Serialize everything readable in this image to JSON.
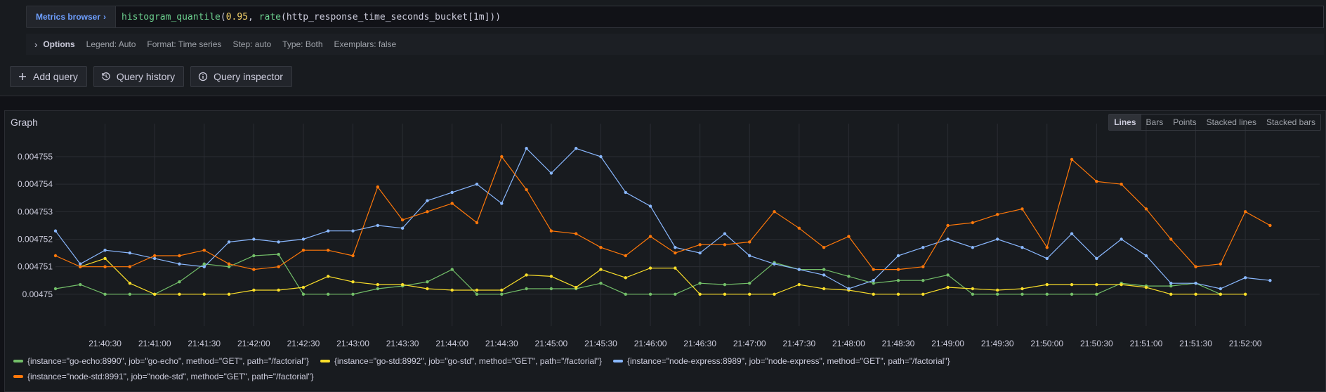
{
  "query": {
    "metrics_browser_label": "Metrics browser",
    "expr_fn1": "histogram_quantile",
    "expr_open1": "(",
    "expr_num1": "0.95",
    "expr_sep1": ", ",
    "expr_fn2": "rate",
    "expr_rest": "(http_response_time_seconds_bucket[1m]))"
  },
  "options": {
    "title": "Options",
    "legend": "Legend: Auto",
    "format": "Format: Time series",
    "step": "Step: auto",
    "type": "Type: Both",
    "exemplars": "Exemplars: false"
  },
  "buttons": {
    "add_query": "Add query",
    "query_history": "Query history",
    "query_inspector": "Query inspector"
  },
  "graph": {
    "title": "Graph",
    "vis_options": [
      "Lines",
      "Bars",
      "Points",
      "Stacked lines",
      "Stacked bars"
    ],
    "active_vis": "Lines"
  },
  "chart_data": {
    "type": "line",
    "ylim": [
      0.004749,
      0.0047562
    ],
    "x_ticks": [
      "21:40:30",
      "21:41:00",
      "21:41:30",
      "21:42:00",
      "21:42:30",
      "21:43:00",
      "21:43:30",
      "21:44:00",
      "21:44:30",
      "21:45:00",
      "21:45:30",
      "21:46:00",
      "21:46:30",
      "21:47:00",
      "21:47:30",
      "21:48:00",
      "21:48:30",
      "21:49:00",
      "21:49:30",
      "21:50:00",
      "21:50:30",
      "21:51:00",
      "21:51:30",
      "21:52:00"
    ],
    "y_ticks": [
      "0.004755",
      "0.004754",
      "0.004753",
      "0.004752",
      "0.004751",
      "0.00475"
    ],
    "y_tick_values": [
      0.004755,
      0.004754,
      0.004753,
      0.004752,
      0.004751,
      0.00475
    ],
    "x_start": "21:40:00",
    "x_step_seconds": 15,
    "grid": true,
    "legend_position": "bottom",
    "series": [
      {
        "name": "{instance=\"go-echo:8990\", job=\"go-echo\", method=\"GET\", path=\"/factorial\"}",
        "color": "#73bf69",
        "values": [
          0.0047502,
          0.00475035,
          0.00475,
          0.00475,
          0.00475,
          0.00475045,
          0.0047511,
          0.004751,
          0.0047514,
          0.00475145,
          0.00475,
          0.00475,
          0.00475,
          0.0047502,
          0.0047503,
          0.00475045,
          0.0047509,
          0.00475,
          0.00475,
          0.0047502,
          0.0047502,
          0.0047502,
          0.0047504,
          0.00475,
          0.00475,
          0.00475,
          0.0047504,
          0.00475035,
          0.0047504,
          0.00475115,
          0.0047509,
          0.0047509,
          0.00475065,
          0.0047504,
          0.0047505,
          0.0047505,
          0.0047507,
          0.00475,
          0.00475,
          0.00475,
          0.00475,
          0.00475,
          0.00475,
          0.0047504,
          0.0047503,
          0.0047503,
          0.0047504,
          0.00475
        ]
      },
      {
        "name": "{instance=\"go-std:8992\", job=\"go-std\", method=\"GET\", path=\"/factorial\"}",
        "color": "#fade2a",
        "values": [
          null,
          0.004751,
          0.0047513,
          0.0047504,
          0.00475,
          0.00475,
          0.00475,
          0.00475,
          0.00475015,
          0.00475015,
          0.00475025,
          0.00475065,
          0.00475045,
          0.00475035,
          0.00475035,
          0.0047502,
          0.00475015,
          0.00475015,
          0.00475015,
          0.0047507,
          0.00475065,
          0.00475025,
          0.0047509,
          0.0047506,
          0.00475095,
          0.00475095,
          0.00475,
          0.00475,
          0.00475,
          0.00475,
          0.00475035,
          0.0047502,
          0.00475015,
          0.00475,
          0.00475,
          0.00475,
          0.00475025,
          0.0047502,
          0.00475015,
          0.0047502,
          0.00475035,
          0.00475035,
          0.00475035,
          0.00475035,
          0.00475025,
          0.00475,
          0.00475,
          0.00475,
          0.00475
        ]
      },
      {
        "name": "{instance=\"node-express:8989\", job=\"node-express\", method=\"GET\", path=\"/factorial\"}",
        "color": "#8ab8ff",
        "values": [
          0.0047523,
          0.0047511,
          0.0047516,
          0.0047515,
          0.0047513,
          0.0047511,
          0.004751,
          0.0047519,
          0.004752,
          0.0047519,
          0.004752,
          0.0047523,
          0.0047523,
          0.0047525,
          0.0047524,
          0.0047534,
          0.0047537,
          0.004754,
          0.0047533,
          0.0047553,
          0.0047544,
          0.0047553,
          0.004755,
          0.0047537,
          0.0047532,
          0.0047517,
          0.0047515,
          0.0047522,
          0.0047514,
          0.0047511,
          0.0047509,
          0.0047507,
          0.0047502,
          0.0047505,
          0.0047514,
          0.0047517,
          0.004752,
          0.0047517,
          0.004752,
          0.0047517,
          0.0047513,
          0.0047522,
          0.0047513,
          0.004752,
          0.0047514,
          0.0047504,
          0.0047504,
          0.0047502,
          0.0047506,
          0.0047505
        ]
      },
      {
        "name": "{instance=\"node-std:8991\", job=\"node-std\", method=\"GET\", path=\"/factorial\"}",
        "color": "#ff780a",
        "values": [
          0.0047514,
          0.004751,
          0.004751,
          0.004751,
          0.0047514,
          0.0047514,
          0.0047516,
          0.0047511,
          0.0047509,
          0.004751,
          0.0047516,
          0.0047516,
          0.0047514,
          0.0047539,
          0.0047527,
          0.004753,
          0.0047533,
          0.0047526,
          0.004755,
          0.0047538,
          0.0047523,
          0.0047522,
          0.0047517,
          0.0047514,
          0.0047521,
          0.0047515,
          0.0047518,
          0.0047518,
          0.0047519,
          0.004753,
          0.0047524,
          0.0047517,
          0.0047521,
          0.0047509,
          0.0047509,
          0.004751,
          0.0047525,
          0.0047526,
          0.0047529,
          0.0047531,
          0.0047517,
          0.0047549,
          0.0047541,
          0.004754,
          0.0047531,
          0.004752,
          0.004751,
          0.0047511,
          0.004753,
          0.0047525
        ]
      }
    ]
  }
}
